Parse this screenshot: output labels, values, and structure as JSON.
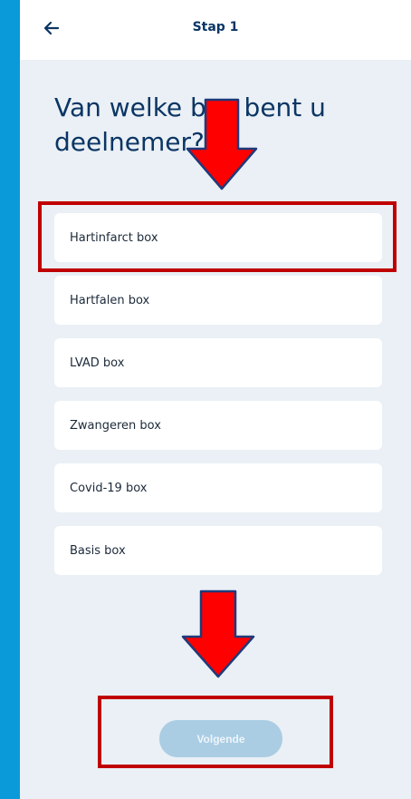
{
  "topbar": {
    "back_icon": "arrow-left-icon",
    "title": "Stap 1"
  },
  "main": {
    "heading": "Van welke box bent u deelnemer?"
  },
  "options": [
    {
      "label": "Hartinfarct box"
    },
    {
      "label": "Hartfalen box"
    },
    {
      "label": "LVAD box"
    },
    {
      "label": "Zwangeren box"
    },
    {
      "label": "Covid-19 box"
    },
    {
      "label": "Basis box"
    }
  ],
  "footer": {
    "next_label": "Volgende",
    "next_disabled": true
  },
  "annotations": {
    "highlight_color": "#c00000",
    "arrow_fill": "#ff0000",
    "arrow_stroke": "#1f3a7a"
  },
  "colors": {
    "frame": "#0a9ad9",
    "background": "#eaf0f5",
    "brand_text": "#0b3564",
    "button_disabled": "#aacde4"
  }
}
